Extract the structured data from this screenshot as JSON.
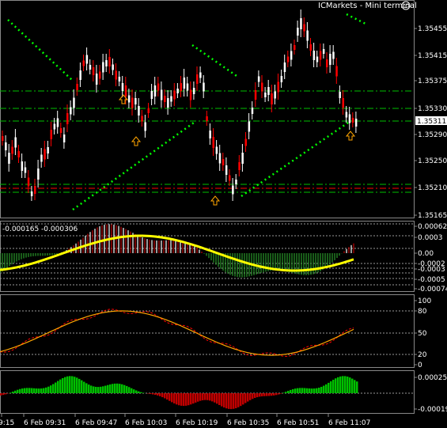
{
  "header": {
    "title": "ICMarkets - Mini terminal",
    "indicator_text": "-0.000165 -0.000306"
  },
  "price_panel": {
    "ticks": [
      "1.35455",
      "1.35415",
      "1.35375",
      "1.35330",
      "1.35290",
      "1.35250",
      "1.35210",
      "1.35165"
    ],
    "current_price": "1.35311"
  },
  "macd_panel": {
    "ticks": [
      "0.00062",
      "0.0003",
      "0.00",
      "-0.0002",
      "-0.0003",
      "-0.0005",
      "-0.00074"
    ]
  },
  "stoch_panel": {
    "ticks": [
      "100",
      "80",
      "50",
      "20",
      "0"
    ]
  },
  "osc_panel": {
    "ticks": [
      "0.00025",
      "-0.00019"
    ]
  },
  "time_axis": {
    "labels": [
      "9:15",
      "6 Feb 09:31",
      "6 Feb 09:47",
      "6 Feb 10:03",
      "6 Feb 10:19",
      "6 Feb 10:35",
      "6 Feb 10:51",
      "6 Feb 11:07"
    ]
  },
  "colors": {
    "background": "#000000",
    "bull": "#ffffff",
    "bear": "#ff0000",
    "trendline": "#00ff00",
    "level_line": "#00c000",
    "arrow": "#ffa500",
    "macd_signal": "#ffff00",
    "osc_pos": "#00c000",
    "osc_neg": "#c00000",
    "stoch_main": "#ffa500",
    "stoch_signal": "#ff0000"
  },
  "icons": {
    "smiley": "smiley-icon",
    "arrow": "up-arrow-icon"
  }
}
